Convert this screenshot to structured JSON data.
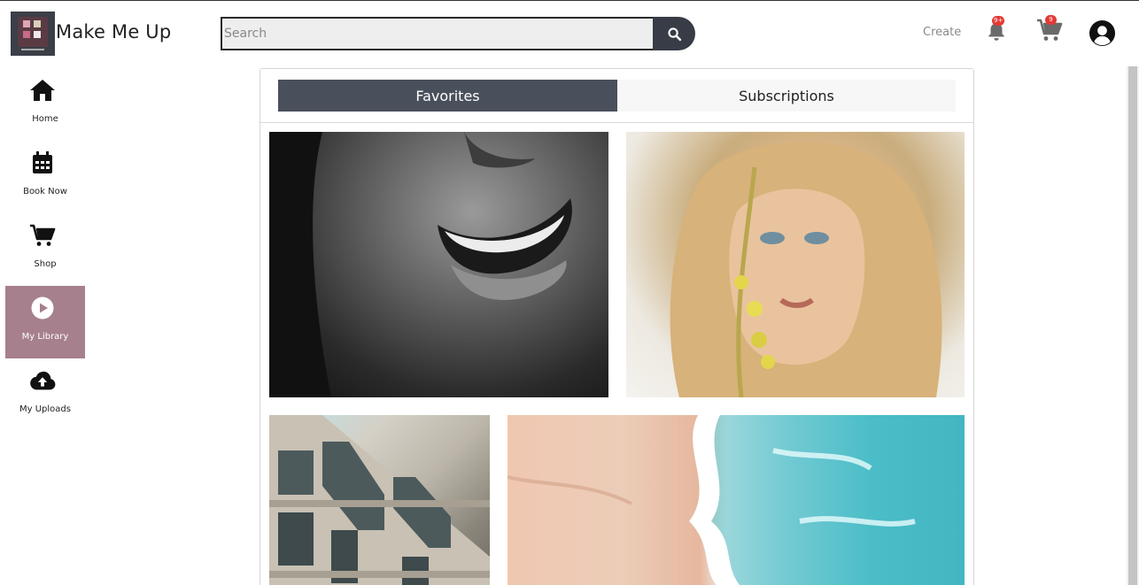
{
  "header": {
    "brand": "Make Me Up",
    "search_placeholder": "Search",
    "create_label": "Create",
    "notifications_badge": "9+",
    "cart_badge": "9"
  },
  "sidebar": {
    "items": [
      {
        "label": "Home",
        "icon": "home-icon"
      },
      {
        "label": "Book Now",
        "icon": "calendar-icon"
      },
      {
        "label": "Shop",
        "icon": "cart-icon"
      },
      {
        "label": "My Library",
        "icon": "play-circle-icon",
        "active": true
      },
      {
        "label": "My Uploads",
        "icon": "cloud-upload-icon"
      }
    ]
  },
  "main": {
    "tabs": [
      {
        "label": "Favorites",
        "active": true
      },
      {
        "label": "Subscriptions",
        "active": false
      }
    ]
  },
  "colors": {
    "accent_sidebar_active": "#a6808c",
    "tab_active": "#4a505b",
    "search_button": "#373c46",
    "badge": "#e53935"
  }
}
